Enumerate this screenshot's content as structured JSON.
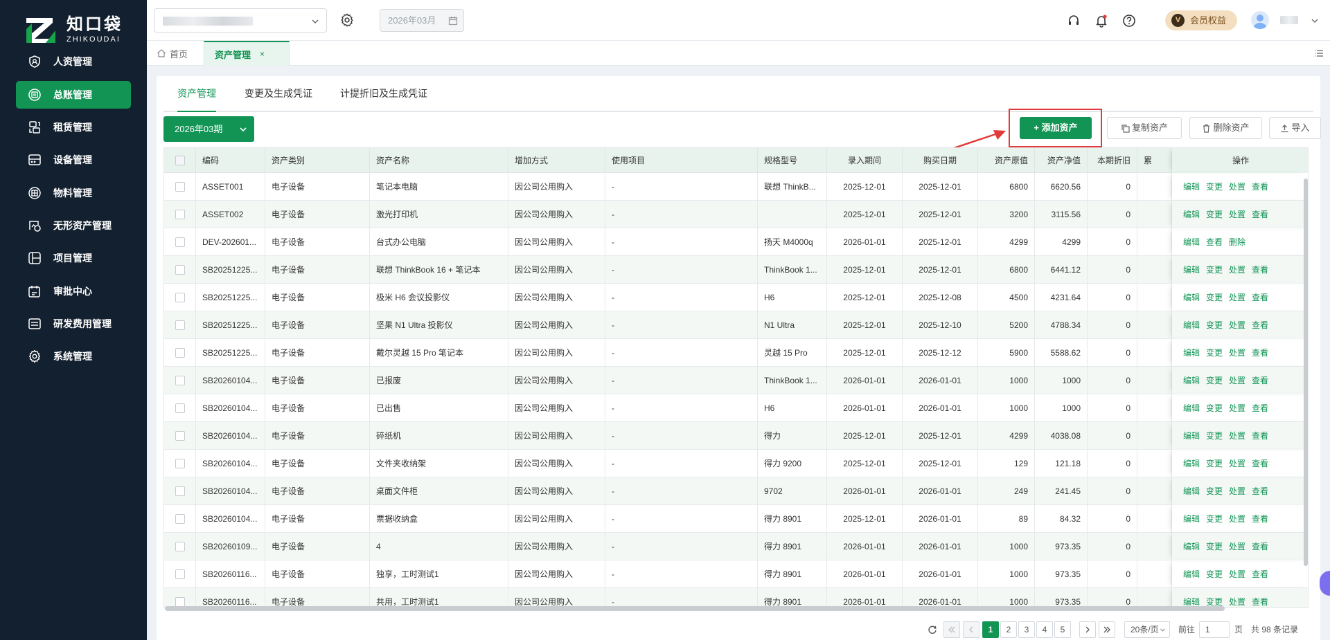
{
  "app": {
    "logo_title": "知口袋",
    "logo_sub": "ZHIKOUDAI",
    "brand_color": "#129455"
  },
  "sidebar": {
    "items": [
      {
        "label": "人资管理",
        "icon": "person-shield-icon",
        "active": false
      },
      {
        "label": "总账管理",
        "icon": "ledger-icon",
        "active": true
      },
      {
        "label": "租赁管理",
        "icon": "lease-icon",
        "active": false
      },
      {
        "label": "设备管理",
        "icon": "device-icon",
        "active": false
      },
      {
        "label": "物料管理",
        "icon": "materials-icon",
        "active": false
      },
      {
        "label": "无形资产管理",
        "icon": "intangible-asset-icon",
        "active": false
      },
      {
        "label": "项目管理",
        "icon": "project-icon",
        "active": false
      },
      {
        "label": "审批中心",
        "icon": "approval-icon",
        "active": false
      },
      {
        "label": "研发费用管理",
        "icon": "rd-expense-icon",
        "active": false
      },
      {
        "label": "系统管理",
        "icon": "gear-icon",
        "active": false
      }
    ]
  },
  "header": {
    "period": "2026年03月",
    "vip_badge": "V",
    "vip_label": "会员权益"
  },
  "tabs": {
    "home": "首页",
    "current": "资产管理",
    "close": "×"
  },
  "subtabs": [
    "资产管理",
    "变更及生成凭证",
    "计提折旧及生成凭证"
  ],
  "toolbar": {
    "period_select": "2026年03期",
    "add": "+ 添加资产",
    "copy": "复制资产",
    "delete": "删除资产",
    "import": "导入"
  },
  "table": {
    "columns": [
      "编码",
      "资产类别",
      "资产名称",
      "增加方式",
      "使用项目",
      "规格型号",
      "录入期间",
      "购买日期",
      "资产原值",
      "资产净值",
      "本期折旧",
      "累",
      "操作"
    ],
    "rows": [
      {
        "code": "ASSET001",
        "category": "电子设备",
        "name": "笔记本电脑",
        "method": "因公司公用购入",
        "project": "-",
        "spec": "联想 ThinkB...",
        "period": "2025-12-01",
        "buy": "2025-12-01",
        "orig": "6800",
        "net": "6620.56",
        "dep": "0",
        "ops": [
          "编辑",
          "变更",
          "处置",
          "查看"
        ]
      },
      {
        "code": "ASSET002",
        "category": "电子设备",
        "name": "激光打印机",
        "method": "因公司公用购入",
        "project": "-",
        "spec": "",
        "period": "2025-12-01",
        "buy": "2025-12-01",
        "orig": "3200",
        "net": "3115.56",
        "dep": "0",
        "ops": [
          "编辑",
          "变更",
          "处置",
          "查看"
        ]
      },
      {
        "code": "DEV-202601...",
        "category": "电子设备",
        "name": "台式办公电脑",
        "method": "因公司公用购入",
        "project": "-",
        "spec": "扬天 M4000q",
        "period": "2026-01-01",
        "buy": "2025-12-01",
        "orig": "4299",
        "net": "4299",
        "dep": "0",
        "ops": [
          "编辑",
          "查看",
          "删除"
        ]
      },
      {
        "code": "SB20251225...",
        "category": "电子设备",
        "name": "联想 ThinkBook 16 + 笔记本",
        "method": "因公司公用购入",
        "project": "-",
        "spec": "ThinkBook 1...",
        "period": "2025-12-01",
        "buy": "2025-12-01",
        "orig": "6800",
        "net": "6441.12",
        "dep": "0",
        "ops": [
          "编辑",
          "变更",
          "处置",
          "查看"
        ]
      },
      {
        "code": "SB20251225...",
        "category": "电子设备",
        "name": "极米 H6 会议投影仪",
        "method": "因公司公用购入",
        "project": "-",
        "spec": "H6",
        "period": "2025-12-01",
        "buy": "2025-12-08",
        "orig": "4500",
        "net": "4231.64",
        "dep": "0",
        "ops": [
          "编辑",
          "变更",
          "处置",
          "查看"
        ]
      },
      {
        "code": "SB20251225...",
        "category": "电子设备",
        "name": "坚果 N1 Ultra 投影仪",
        "method": "因公司公用购入",
        "project": "-",
        "spec": "N1 Ultra",
        "period": "2025-12-01",
        "buy": "2025-12-10",
        "orig": "5200",
        "net": "4788.34",
        "dep": "0",
        "ops": [
          "编辑",
          "变更",
          "处置",
          "查看"
        ]
      },
      {
        "code": "SB20251225...",
        "category": "电子设备",
        "name": "戴尔灵越 15 Pro 笔记本",
        "method": "因公司公用购入",
        "project": "-",
        "spec": "灵越 15 Pro",
        "period": "2025-12-01",
        "buy": "2025-12-12",
        "orig": "5900",
        "net": "5588.62",
        "dep": "0",
        "ops": [
          "编辑",
          "变更",
          "处置",
          "查看"
        ]
      },
      {
        "code": "SB20260104...",
        "category": "电子设备",
        "name": "已报废",
        "method": "因公司公用购入",
        "project": "-",
        "spec": "ThinkBook 1...",
        "period": "2026-01-01",
        "buy": "2026-01-01",
        "orig": "1000",
        "net": "1000",
        "dep": "0",
        "ops": [
          "编辑",
          "变更",
          "处置",
          "查看"
        ]
      },
      {
        "code": "SB20260104...",
        "category": "电子设备",
        "name": "已出售",
        "method": "因公司公用购入",
        "project": "-",
        "spec": "H6",
        "period": "2026-01-01",
        "buy": "2026-01-01",
        "orig": "1000",
        "net": "1000",
        "dep": "0",
        "ops": [
          "编辑",
          "变更",
          "处置",
          "查看"
        ]
      },
      {
        "code": "SB20260104...",
        "category": "电子设备",
        "name": "碎纸机",
        "method": "因公司公用购入",
        "project": "-",
        "spec": "得力",
        "period": "2025-12-01",
        "buy": "2025-12-01",
        "orig": "4299",
        "net": "4038.08",
        "dep": "0",
        "ops": [
          "编辑",
          "变更",
          "处置",
          "查看"
        ]
      },
      {
        "code": "SB20260104...",
        "category": "电子设备",
        "name": "文件夹收纳架",
        "method": "因公司公用购入",
        "project": "-",
        "spec": "得力 9200",
        "period": "2025-12-01",
        "buy": "2025-12-01",
        "orig": "129",
        "net": "121.18",
        "dep": "0",
        "ops": [
          "编辑",
          "变更",
          "处置",
          "查看"
        ]
      },
      {
        "code": "SB20260104...",
        "category": "电子设备",
        "name": "桌面文件柜",
        "method": "因公司公用购入",
        "project": "-",
        "spec": "9702",
        "period": "2026-01-01",
        "buy": "2026-01-01",
        "orig": "249",
        "net": "241.45",
        "dep": "0",
        "ops": [
          "编辑",
          "变更",
          "处置",
          "查看"
        ]
      },
      {
        "code": "SB20260104...",
        "category": "电子设备",
        "name": "票据收纳盒",
        "method": "因公司公用购入",
        "project": "-",
        "spec": "得力 8901",
        "period": "2025-12-01",
        "buy": "2026-01-01",
        "orig": "89",
        "net": "84.32",
        "dep": "0",
        "ops": [
          "编辑",
          "变更",
          "处置",
          "查看"
        ]
      },
      {
        "code": "SB20260109...",
        "category": "电子设备",
        "name": "4",
        "method": "因公司公用购入",
        "project": "-",
        "spec": "得力 8901",
        "period": "2026-01-01",
        "buy": "2026-01-01",
        "orig": "1000",
        "net": "973.35",
        "dep": "0",
        "ops": [
          "编辑",
          "变更",
          "处置",
          "查看"
        ]
      },
      {
        "code": "SB20260116...",
        "category": "电子设备",
        "name": "独享，工时测试1",
        "method": "因公司公用购入",
        "project": "-",
        "spec": "得力 8901",
        "period": "2026-01-01",
        "buy": "2026-01-01",
        "orig": "1000",
        "net": "973.35",
        "dep": "0",
        "ops": [
          "编辑",
          "变更",
          "处置",
          "查看"
        ]
      },
      {
        "code": "SB20260116...",
        "category": "电子设备",
        "name": "共用，工时测试1",
        "method": "因公司公用购入",
        "project": "-",
        "spec": "得力 8901",
        "period": "2026-01-01",
        "buy": "2026-01-01",
        "orig": "1000",
        "net": "973.35",
        "dep": "0",
        "ops": [
          "编辑",
          "变更",
          "处置",
          "查看"
        ]
      }
    ]
  },
  "pagination": {
    "pages": [
      "1",
      "2",
      "3",
      "4",
      "5"
    ],
    "current": "1",
    "page_size": "20条/页",
    "goto_prefix": "前往",
    "goto_value": "1",
    "goto_suffix": "页",
    "total": "共 98 条记录"
  }
}
